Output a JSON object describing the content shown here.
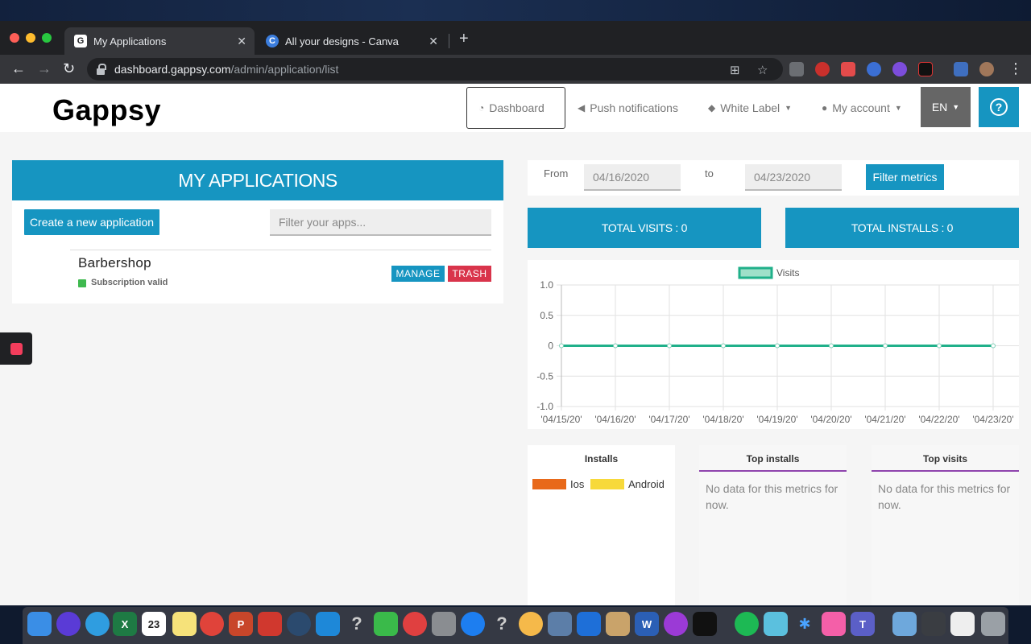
{
  "browser": {
    "tabs": [
      {
        "title": "My Applications",
        "favicon": "G",
        "active": true
      },
      {
        "title": "All your designs - Canva",
        "favicon": "C",
        "active": false
      }
    ],
    "url_host": "dashboard.gappsy.com",
    "url_path": "/admin/application/list"
  },
  "header": {
    "logo": "Gappsy",
    "nav": {
      "dashboard": "Dashboard",
      "push": "Push notifications",
      "white_label": "White Label",
      "account": "My account"
    },
    "lang": "EN",
    "help": "?"
  },
  "apps": {
    "title": "MY APPLICATIONS",
    "create_label": "Create a new application",
    "filter_placeholder": "Filter your apps...",
    "items": [
      {
        "name": "Barbershop",
        "status": "Subscription valid",
        "manage": "MANAGE",
        "trash": "TRASH"
      }
    ]
  },
  "metrics": {
    "from_label": "From",
    "to_label": "to",
    "from_date": "04/16/2020",
    "to_date": "04/23/2020",
    "filter_label": "Filter metrics",
    "total_visits": "TOTAL VISITS : 0",
    "total_installs": "TOTAL INSTALLS : 0"
  },
  "chart_data": {
    "type": "line",
    "legend": "Visits",
    "categories": [
      "'04/15/20'",
      "'04/16/20'",
      "'04/17/20'",
      "'04/18/20'",
      "'04/19/20'",
      "'04/20/20'",
      "'04/21/20'",
      "'04/22/20'",
      "'04/23/20'"
    ],
    "series": [
      {
        "name": "Visits",
        "values": [
          0,
          0,
          0,
          0,
          0,
          0,
          0,
          0,
          0
        ]
      }
    ],
    "yticks": [
      "1.0",
      "0.5",
      "0",
      "-0.5",
      "-1.0"
    ],
    "ylim": [
      -1,
      1
    ],
    "grid": true,
    "color": "#20b08a"
  },
  "cards": {
    "installs": {
      "title": "Installs",
      "legend": [
        {
          "label": "Ios",
          "color": "#e8691a"
        },
        {
          "label": "Android",
          "color": "#f7d93a"
        }
      ]
    },
    "top_installs": {
      "title": "Top installs",
      "note": "No data for this metrics for now."
    },
    "top_visits": {
      "title": "Top visits",
      "note": "No data for this metrics for now."
    }
  },
  "colors": {
    "primary": "#1695c1",
    "danger": "#d9344b",
    "success": "#3fb94f"
  }
}
